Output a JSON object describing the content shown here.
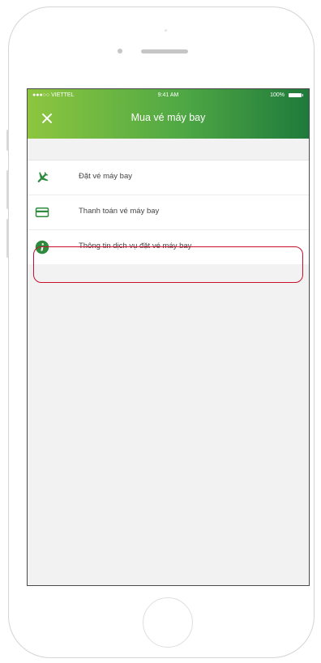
{
  "status_bar": {
    "carrier": "●●●○○ VIETTEL",
    "time": "9:41 AM",
    "battery": "100%"
  },
  "header": {
    "title": "Mua vé máy bay",
    "close_icon": "close-icon"
  },
  "menu": {
    "items": [
      {
        "label": "Đặt vé máy bay",
        "icon": "airplane-icon"
      },
      {
        "label": "Thanh toán vé máy bay",
        "icon": "credit-card-icon"
      },
      {
        "label": "Thông tin dịch vụ đặt vé máy bay",
        "icon": "info-icon",
        "highlighted": true
      }
    ]
  },
  "colors": {
    "header_gradient_start": "#8dc63f",
    "header_gradient_end": "#1f7a3b",
    "icon_green": "#2e8b3e",
    "highlight_border": "#c8102e"
  }
}
